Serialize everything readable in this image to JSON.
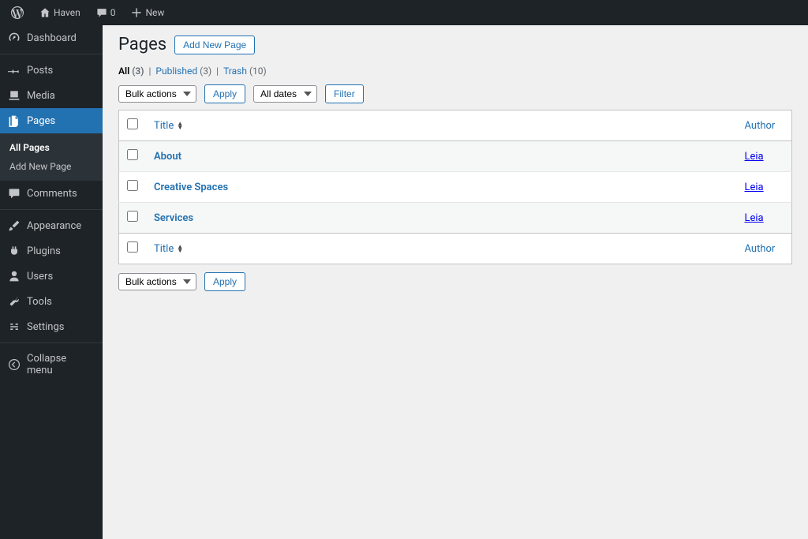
{
  "topbar": {
    "site_name": "Haven",
    "comments_count": "0",
    "new_label": "New"
  },
  "sidebar": {
    "items": [
      {
        "label": "Dashboard"
      },
      {
        "label": "Posts"
      },
      {
        "label": "Media"
      },
      {
        "label": "Pages"
      },
      {
        "label": "Comments"
      },
      {
        "label": "Appearance"
      },
      {
        "label": "Plugins"
      },
      {
        "label": "Users"
      },
      {
        "label": "Tools"
      },
      {
        "label": "Settings"
      }
    ],
    "sub_pages": {
      "all": "All Pages",
      "add": "Add New Page"
    },
    "collapse": "Collapse menu"
  },
  "main": {
    "title": "Pages",
    "add_new_btn": "Add New Page",
    "filters": {
      "all_label": "All",
      "all_count": "(3)",
      "pub_label": "Published",
      "pub_count": "(3)",
      "trash_label": "Trash",
      "trash_count": "(10)"
    },
    "bulk_label": "Bulk actions",
    "apply_label": "Apply",
    "dates_label": "All dates",
    "filter_btn": "Filter",
    "columns": {
      "title": "Title",
      "author": "Author"
    },
    "rows": [
      {
        "title": "About",
        "author": "Leia"
      },
      {
        "title": "Creative Spaces",
        "author": "Leia"
      },
      {
        "title": "Services",
        "author": "Leia"
      }
    ]
  }
}
